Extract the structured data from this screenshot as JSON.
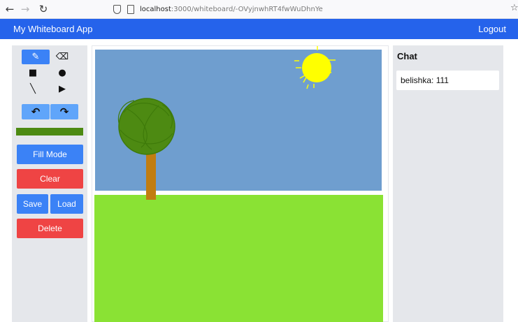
{
  "browser": {
    "url_host": "localhost",
    "url_rest": ":3000/whiteboard/-OVyjnwhRT4fwWuDhnYe",
    "back_icon": "←",
    "forward_icon": "→",
    "reload_icon": "↻"
  },
  "header": {
    "title": "My Whiteboard App",
    "logout_label": "Logout"
  },
  "toolbar": {
    "tools": {
      "pencil": "✎",
      "eraser": "⌫",
      "square": "■",
      "circle": "●",
      "line": "╲",
      "triangle": "▶"
    },
    "undo_icon": "↶",
    "redo_icon": "↷",
    "current_color": "#4d8a12",
    "fill_mode_label": "Fill Mode",
    "clear_label": "Clear",
    "save_label": "Save",
    "load_label": "Load",
    "delete_label": "Delete"
  },
  "chat": {
    "title": "Chat",
    "messages": [
      {
        "text": "belishka: 111"
      }
    ]
  },
  "colors": {
    "header": "#2563eb",
    "sky": "#6f9ecf",
    "grass": "#8ae234",
    "sun": "#ffff00",
    "tree_leaves": "#4d8a12",
    "tree_trunk": "#c17d11"
  }
}
